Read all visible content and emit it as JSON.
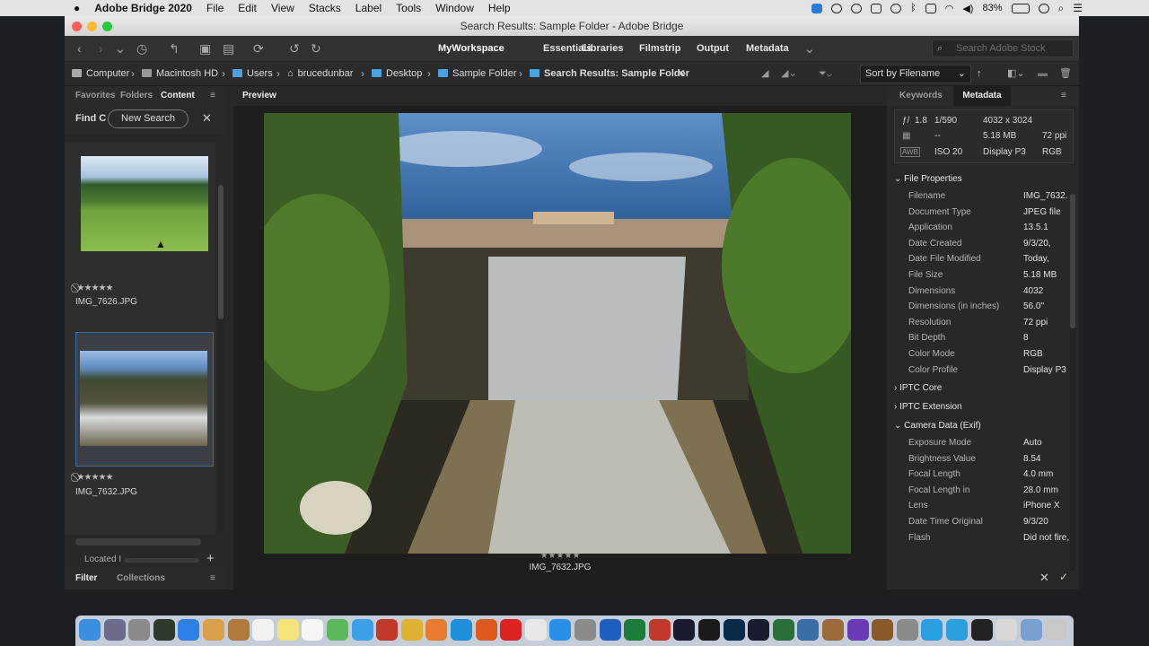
{
  "menubar": {
    "app": "Adobe Bridge 2020",
    "items": [
      "File",
      "Edit",
      "View",
      "Stacks",
      "Label",
      "Tools",
      "Window",
      "Help"
    ],
    "battery": "83%"
  },
  "window": {
    "title": "Search Results: Sample Folder - Adobe Bridge"
  },
  "workspaces": [
    "MyWorkspace",
    "Essentials",
    "Libraries",
    "Filmstrip",
    "Output",
    "Metadata"
  ],
  "search": {
    "placeholder": "Search Adobe Stock"
  },
  "path": [
    "Computer",
    "Macintosh HD",
    "Users",
    "brucedunbar",
    "Desktop",
    "Sample Folder",
    "Search Results: Sample Folder"
  ],
  "sort": {
    "label": "Sort by Filename"
  },
  "left": {
    "tabs": [
      "Favorites",
      "Folders",
      "Content"
    ],
    "find_label": "Find C",
    "new_search": "New Search",
    "located": "Located I",
    "bottom_tabs": [
      "Filter",
      "Collections"
    ]
  },
  "thumbnails": [
    {
      "name": "IMG_7626.JPG",
      "stars": "★★★★★"
    },
    {
      "name": "IMG_7632.JPG",
      "stars": "★★★★★"
    }
  ],
  "preview": {
    "tab": "Preview",
    "filename": "IMG_7632.JPG",
    "stars": "★★★★★"
  },
  "right": {
    "tabs": [
      "Keywords",
      "Metadata"
    ]
  },
  "camera_summary": {
    "aperture": "1.8",
    "shutter": "1/590",
    "dims": "4032 x 3024",
    "size": "5.18 MB",
    "ppi": "72 ppi",
    "exposure": "--",
    "iso": "ISO 20",
    "profile": "Display P3",
    "mode": "RGB"
  },
  "sections": {
    "file": "File Properties",
    "iptc_core": "IPTC Core",
    "iptc_ext": "IPTC Extension",
    "camera": "Camera Data (Exif)"
  },
  "file_properties": [
    {
      "k": "Filename",
      "v": "IMG_7632."
    },
    {
      "k": "Document Type",
      "v": "JPEG file"
    },
    {
      "k": "Application",
      "v": "13.5.1"
    },
    {
      "k": "Date Created",
      "v": "9/3/20,"
    },
    {
      "k": "Date File Modified",
      "v": "Today,"
    },
    {
      "k": "File Size",
      "v": "5.18 MB"
    },
    {
      "k": "Dimensions",
      "v": "4032"
    },
    {
      "k": "Dimensions (in inches)",
      "v": "56.0\""
    },
    {
      "k": "Resolution",
      "v": "72 ppi"
    },
    {
      "k": "Bit Depth",
      "v": "8"
    },
    {
      "k": "Color Mode",
      "v": "RGB"
    },
    {
      "k": "Color Profile",
      "v": "Display P3"
    }
  ],
  "camera_data": [
    {
      "k": "Exposure Mode",
      "v": "Auto"
    },
    {
      "k": "Brightness Value",
      "v": "8.54"
    },
    {
      "k": "Focal Length",
      "v": "4.0 mm"
    },
    {
      "k": "Focal Length in",
      "v": "28.0 mm"
    },
    {
      "k": "Lens",
      "v": "iPhone X"
    },
    {
      "k": "Date Time Original",
      "v": "9/3/20"
    },
    {
      "k": "Flash",
      "v": "Did not fire,"
    }
  ],
  "colors": {
    "accent": "#2e6fd6",
    "folder": "#4aa3df",
    "selection": "#3a6ea5"
  }
}
